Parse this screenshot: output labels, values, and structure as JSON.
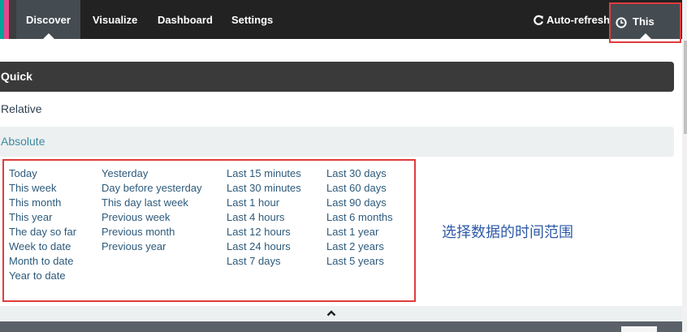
{
  "nav": {
    "tabs": [
      {
        "label": "Discover",
        "active": true
      },
      {
        "label": "Visualize",
        "active": false
      },
      {
        "label": "Dashboard",
        "active": false
      },
      {
        "label": "Settings",
        "active": false
      }
    ],
    "auto_refresh_label": "Auto-refresh",
    "auto_refresh_icon": "refresh-icon",
    "time_picker_label": "This week",
    "time_picker_icon": "clock-icon"
  },
  "modes": {
    "quick": "Quick",
    "relative": "Relative",
    "absolute": "Absolute"
  },
  "quick_options": {
    "col1": [
      "Today",
      "This week",
      "This month",
      "This year",
      "The day so far",
      "Week to date",
      "Month to date",
      "Year to date"
    ],
    "col2": [
      "Yesterday",
      "Day before yesterday",
      "This day last week",
      "Previous week",
      "Previous month",
      "Previous year"
    ],
    "col3": [
      "Last 15 minutes",
      "Last 30 minutes",
      "Last 1 hour",
      "Last 4 hours",
      "Last 12 hours",
      "Last 24 hours",
      "Last 7 days"
    ],
    "col4": [
      "Last 30 days",
      "Last 60 days",
      "Last 90 days",
      "Last 6 months",
      "Last 1 year",
      "Last 2 years",
      "Last 5 years"
    ]
  },
  "annotation_text": "选择数据的时间范围",
  "colors": {
    "navbar": "#222222",
    "active_tab": "#444c52",
    "highlight_border": "#e03c3c",
    "link": "#2d5a7b"
  }
}
